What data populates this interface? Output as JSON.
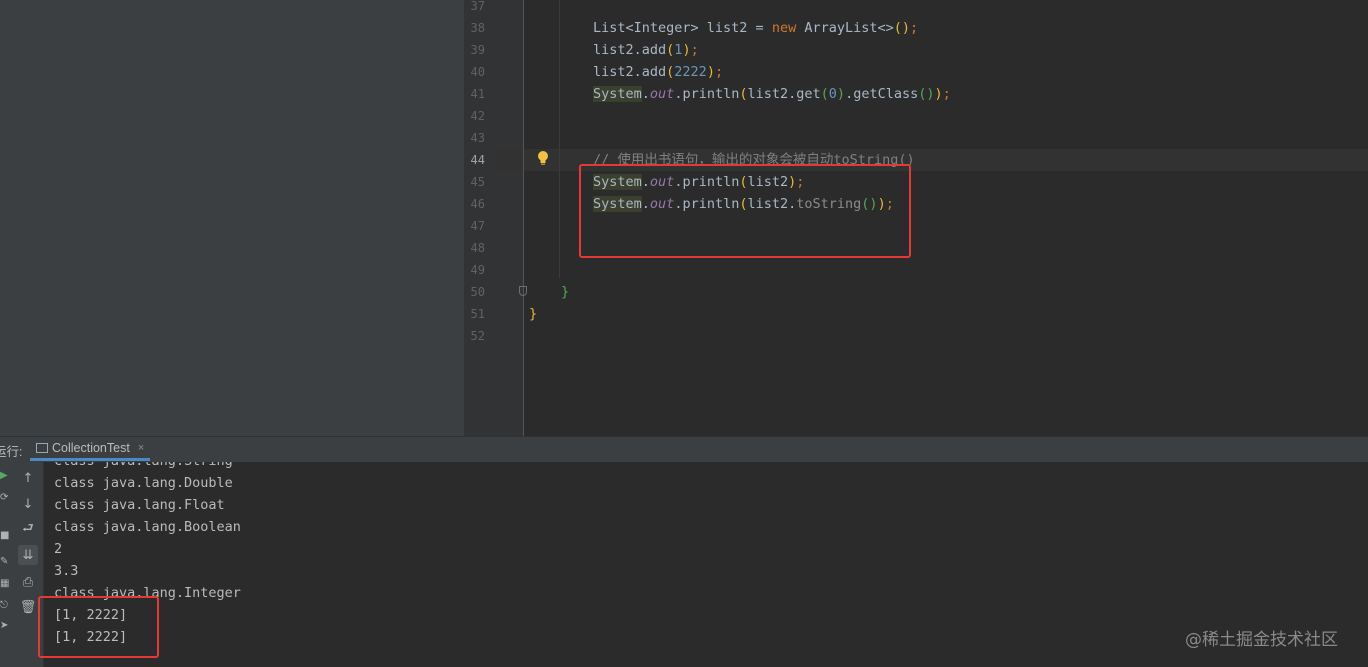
{
  "editor": {
    "line_numbers": [
      "37",
      "38",
      "39",
      "40",
      "41",
      "42",
      "43",
      "44",
      "45",
      "46",
      "47",
      "48",
      "49",
      "50",
      "51",
      "52"
    ],
    "current_line": "44",
    "code": {
      "l38": {
        "t1": "List<Integer> list2 = ",
        "kw": "new",
        "t2": " ArrayList<>",
        "p1": "()",
        "t3": ";"
      },
      "l39": {
        "t1": "list2.add",
        "p1": "(",
        "n": "1",
        "p2": ")",
        "t2": ";"
      },
      "l40": {
        "t1": "list2.add",
        "p1": "(",
        "n": "2222",
        "p2": ")",
        "t2": ";"
      },
      "l41": {
        "sys": "System",
        "dot": ".",
        "field": "out",
        "t1": ".println",
        "p1": "(",
        "t2": "list2.get",
        "p2": "(",
        "n": "0",
        "p3": ")",
        "t3": ".getClass",
        "p4": "()",
        "p5": ")",
        "t4": ";"
      },
      "l44": {
        "comment": "// 使用出书语句，输出的对象会被自动toString()"
      },
      "l45": {
        "sys": "System",
        "dot": ".",
        "field": "out",
        "t1": ".println",
        "p1": "(",
        "t2": "list2",
        "p2": ")",
        "t3": ";"
      },
      "l46": {
        "sys": "System",
        "dot": ".",
        "field": "out",
        "t1": ".println",
        "p1": "(",
        "t2": "list2.",
        "m": "toString",
        "p2": "()",
        "p3": ")",
        "t3": ";"
      },
      "l50": {
        "brace": "}"
      },
      "l51": {
        "brace": "}"
      }
    }
  },
  "run_window": {
    "title": "运行:",
    "tab_label": "CollectionTest",
    "tab_close": "×",
    "output_lines": [
      "class java.lang.String",
      "class java.lang.Double",
      "class java.lang.Float",
      "class java.lang.Boolean",
      "2",
      "3.3",
      "class java.lang.Integer",
      "[1, 2222]",
      "[1, 2222]"
    ],
    "toolbar_icons": [
      "up-arrow-icon",
      "down-arrow-icon",
      "soft-wrap-icon",
      "scroll-to-end-icon",
      "print-icon",
      "trash-icon"
    ]
  },
  "watermark": "@稀土掘金技术社区",
  "colors": {
    "highlight": "#e53935",
    "keyword": "#cc7832",
    "number": "#6897bb",
    "field": "#9876aa",
    "comment": "#808080",
    "background": "#2b2b2b"
  }
}
